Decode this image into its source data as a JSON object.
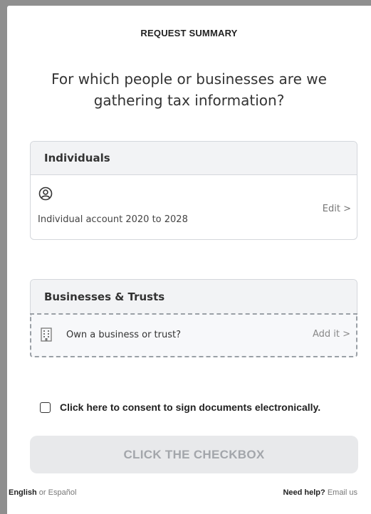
{
  "header": {
    "title": "REQUEST SUMMARY"
  },
  "question": "For which people or businesses are we gathering tax information?",
  "individuals": {
    "heading": "Individuals",
    "account_text": "Individual account 2020 to 2028",
    "edit_label": "Edit >"
  },
  "businesses": {
    "heading": "Businesses & Trusts",
    "prompt": "Own a business or trust?",
    "add_label": "Add it >"
  },
  "consent": {
    "label": "Click here to consent to sign documents electronically.",
    "checked": false
  },
  "cta": {
    "label": "CLICK THE CHECKBOX"
  },
  "footer": {
    "lang_en": "English",
    "lang_or": "or",
    "lang_es": "Español",
    "help_label": "Need help?",
    "email_label": "Email us"
  },
  "colors": {
    "card_header_bg": "#f2f3f5",
    "button_disabled_bg": "#e8e9eb",
    "button_disabled_text": "#a3a6ab"
  },
  "icons": {
    "person": "person-circle-icon",
    "building": "building-icon"
  }
}
